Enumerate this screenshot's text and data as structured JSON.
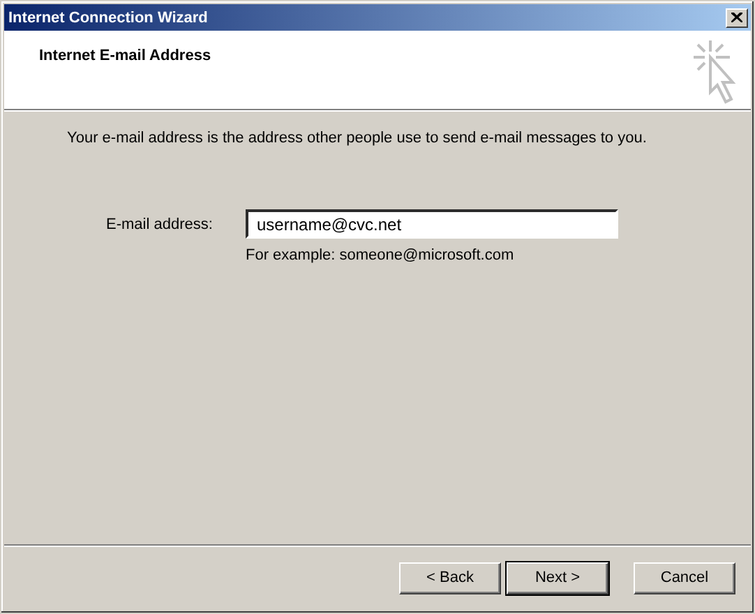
{
  "window": {
    "title": "Internet Connection Wizard"
  },
  "header": {
    "title": "Internet E-mail Address"
  },
  "description": "Your e-mail address is the address other people use to send e-mail messages to you.",
  "email_field": {
    "label": "E-mail address:",
    "value": "username@cvc.net",
    "hint": "For example: someone@microsoft.com"
  },
  "buttons": [
    {
      "label": "< Back",
      "default": false
    },
    {
      "label": "Next >",
      "default": true
    },
    {
      "label": "Cancel",
      "default": false
    }
  ]
}
